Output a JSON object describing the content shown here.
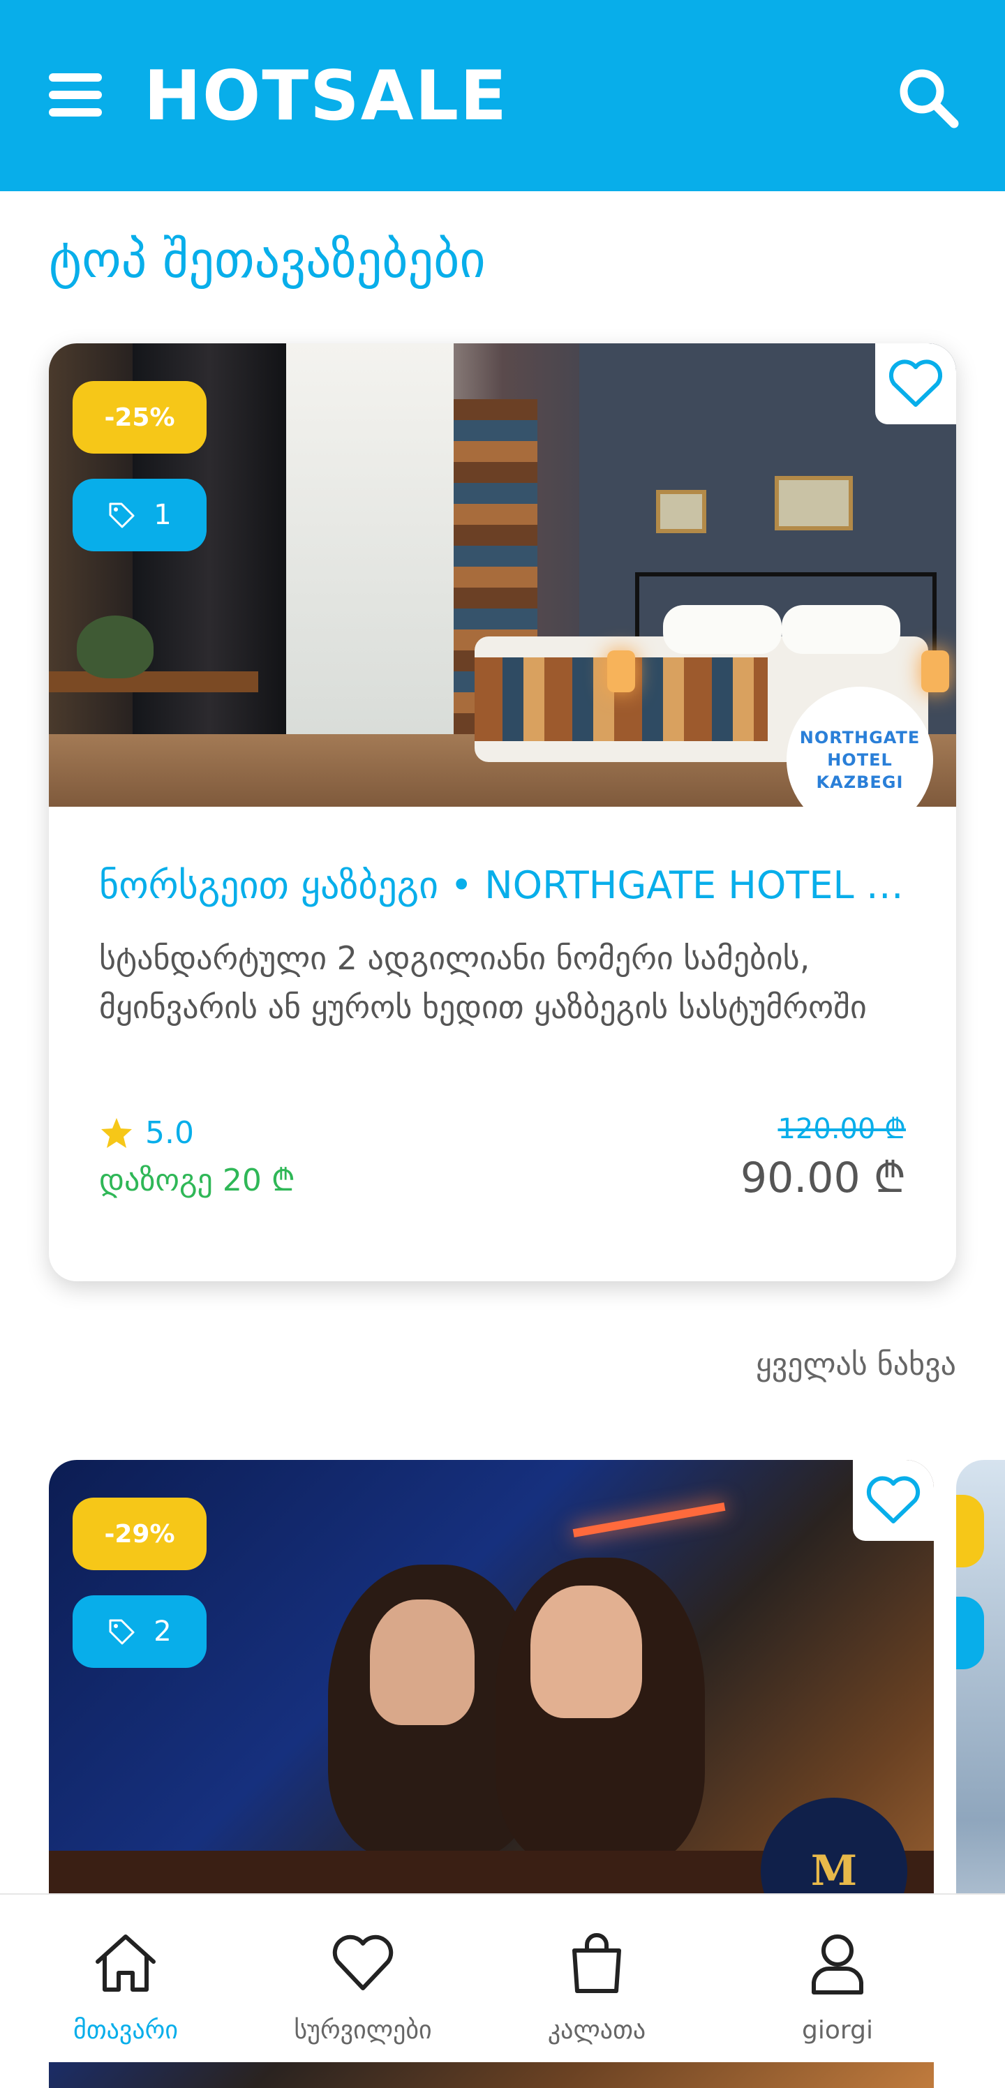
{
  "colors": {
    "brand_blue": "#08aeea",
    "badge_yellow": "#f6c718",
    "savings_green": "#2fb757",
    "text_gray": "#555555"
  },
  "header": {
    "menu_icon": "hamburger-icon",
    "brand": "HOTSALE",
    "search_icon": "search-icon"
  },
  "section": {
    "title": "ტოპ შეთავაზებები"
  },
  "offer": {
    "discount": "-25%",
    "tag_count": "1",
    "hotel_logo_text": "NORTHGATE HOTEL KAZBEGI",
    "title": "ნორსგეით ყაზბეგი • NORTHGATE HOTEL KAZBEGI",
    "description": "სტანდარტული 2 ადგილიანი ნომერი სამების, მყინვარის ან ყუროს ხედით ყაზბეგის სასტუმროში",
    "rating": "5.0",
    "savings": "დაზოგე 20 ₾",
    "old_price": "120.00 ₾",
    "new_price": "90.00 ₾"
  },
  "see_all": "ყველას ნახვა",
  "offer2": {
    "discount": "-29%",
    "tag_count": "2",
    "logo_text": "M"
  },
  "nav": {
    "items": [
      {
        "label": "მთავარი",
        "icon": "home-icon",
        "active": true
      },
      {
        "label": "სურვილები",
        "icon": "heart-icon",
        "active": false
      },
      {
        "label": "კალათა",
        "icon": "shopping-bag-icon",
        "active": false
      },
      {
        "label": "giorgi",
        "icon": "user-icon",
        "active": false
      }
    ]
  }
}
